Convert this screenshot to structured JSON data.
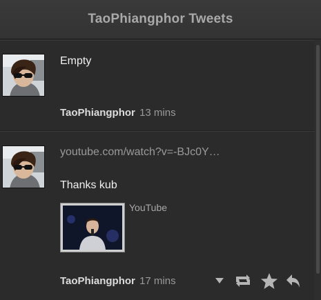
{
  "header": {
    "title": "TaoPhiangphor Tweets"
  },
  "tweets": [
    {
      "text": "Empty",
      "author": "TaoPhiangphor",
      "time": "13 mins"
    },
    {
      "link": "youtube.com/watch?v=-BJc0Y…",
      "text": "Thanks kub",
      "media_label": "YouTube",
      "author": "TaoPhiangphor",
      "time": "17 mins"
    }
  ],
  "icons": {
    "more": "chevron-down-icon",
    "retweet": "retweet-icon",
    "favorite": "star-icon",
    "reply": "reply-icon"
  },
  "colors": {
    "background": "#2b2b2b",
    "header": "#363636",
    "title": "#a9a9a9",
    "muted_text": "#9a9a9a",
    "icon": "#b5b5b5"
  }
}
